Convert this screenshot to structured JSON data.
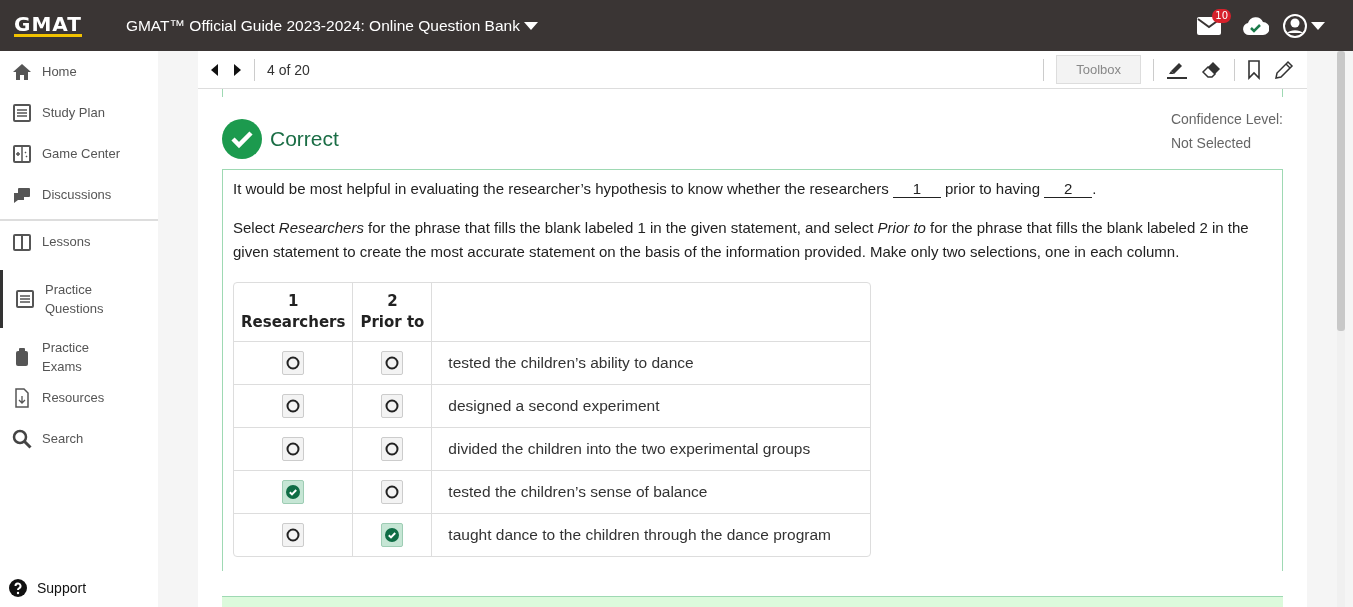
{
  "header": {
    "logo": "GMAT",
    "title": "GMAT™ Official Guide 2023-2024: Online Question Bank",
    "notifications": "10"
  },
  "sidebar": {
    "sections": [
      [
        {
          "label": "Home",
          "selected": false
        },
        {
          "label": "Study Plan",
          "selected": false
        },
        {
          "label": "Game Center",
          "selected": false
        },
        {
          "label": "Discussions",
          "selected": false
        }
      ],
      [
        {
          "label": "Lessons",
          "selected": false
        },
        {
          "label": "Practice Questions",
          "selected": true
        },
        {
          "label": "Practice Exams",
          "selected": false
        },
        {
          "label": "Resources",
          "selected": false
        },
        {
          "label": "Search",
          "selected": false
        }
      ]
    ],
    "support": "Support"
  },
  "toolbar": {
    "position": "4 of 20",
    "toolbox": "Toolbox"
  },
  "result": {
    "label": "Correct",
    "correct": true
  },
  "confidence": {
    "label": "Confidence Level:",
    "value": "Not Selected"
  },
  "question": {
    "statement_parts": [
      "It would be most helpful in evaluating the researcher’s hypothesis to know whether the researchers ",
      "1",
      " prior to having ",
      "2",
      "."
    ],
    "instructions": "Select *Researchers* for the phrase that fills the blank labeled 1 in the given statement, and select *Prior to* for the phrase that fills the blank labeled 2 in the given statement to create the most accurate statement on the basis of the information provided. Make only two selections, one in each column."
  },
  "table": {
    "columns": [
      {
        "number": "1",
        "label": "Researchers"
      },
      {
        "number": "2",
        "label": "Prior to"
      }
    ],
    "rows": [
      {
        "text": "tested the children’s ability to dance",
        "col1_selected": false,
        "col2_selected": false
      },
      {
        "text": "designed a second experiment",
        "col1_selected": false,
        "col2_selected": false
      },
      {
        "text": "divided the children into the two experimental groups",
        "col1_selected": false,
        "col2_selected": false
      },
      {
        "text": "tested the children’s sense of balance",
        "col1_selected": true,
        "col2_selected": false
      },
      {
        "text": "taught dance to the children through the dance program",
        "col1_selected": false,
        "col2_selected": true
      }
    ]
  }
}
